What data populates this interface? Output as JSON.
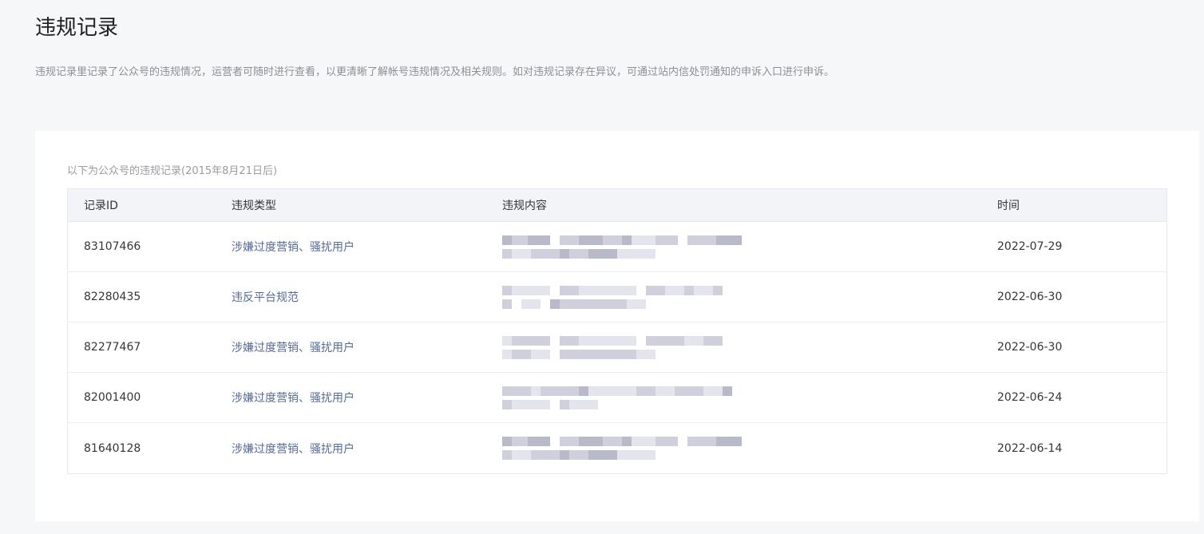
{
  "header": {
    "title": "违规记录",
    "description": "违规记录里记录了公众号的违规情况，运营者可随时进行查看，以更清晰了解帐号违规情况及相关规则。如对违规记录存在异议，可通过站内信处罚通知的申诉入口进行申诉。"
  },
  "section": {
    "caption": "以下为公众号的违规记录(2015年8月21日后)"
  },
  "table": {
    "columns": {
      "id": "记录ID",
      "type": "违规类型",
      "content": "违规内容",
      "time": "时间"
    },
    "rows": [
      {
        "id": "83107466",
        "type": "涉嫌过度营销、骚扰用户",
        "time": "2022-07-29"
      },
      {
        "id": "82280435",
        "type": "违反平台规范",
        "time": "2022-06-30"
      },
      {
        "id": "82277467",
        "type": "涉嫌过度营销、骚扰用户",
        "time": "2022-06-30"
      },
      {
        "id": "82001400",
        "type": "涉嫌过度营销、骚扰用户",
        "time": "2022-06-24"
      },
      {
        "id": "81640128",
        "type": "涉嫌过度营销、骚扰用户",
        "time": "2022-06-14"
      }
    ]
  },
  "colors": {
    "link": "#576b95",
    "background": "#f6f7f9",
    "pixelate_dark": "#b9bac9",
    "pixelate_mid": "#cfd0dc",
    "pixelate_light": "#e4e5ec"
  }
}
